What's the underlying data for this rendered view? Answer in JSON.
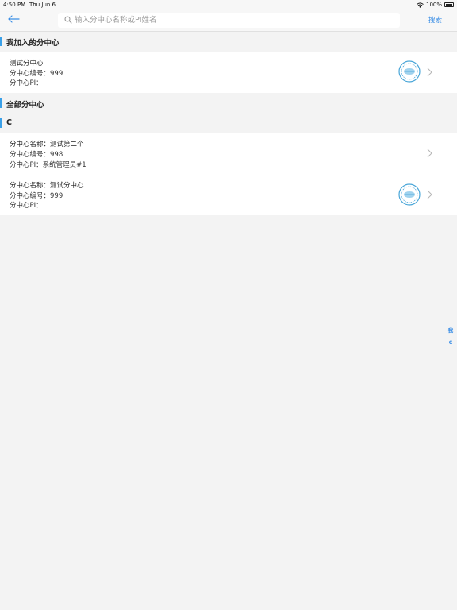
{
  "status_bar": {
    "time": "4:50 PM",
    "date": "Thu Jun 6",
    "battery": "100%"
  },
  "nav": {
    "back_icon": "arrow-left-icon",
    "search_placeholder": "输入分中心名称或PI姓名",
    "search_value": "",
    "search_button": "搜索"
  },
  "sections": {
    "joined_title": "我加入的分中心",
    "all_title": "全部分中心",
    "letter_c": "C"
  },
  "joined_centers": [
    {
      "name": "测试分中心",
      "number_label": "分中心编号：",
      "number": "999",
      "pi_label": "分中心PI：",
      "pi": "",
      "has_stamp": true
    }
  ],
  "all_centers": [
    {
      "name_label": "分中心名称：",
      "name": "测试第二个",
      "number_label": "分中心编号：",
      "number": "998",
      "pi_label": "分中心PI：",
      "pi": "系统管理员#1",
      "has_stamp": false
    },
    {
      "name_label": "分中心名称：",
      "name": "测试分中心",
      "number_label": "分中心编号：",
      "number": "999",
      "pi_label": "分中心PI：",
      "pi": "",
      "has_stamp": true
    }
  ],
  "index_bar": [
    "我",
    "C"
  ],
  "colors": {
    "accent": "#3a8ee6",
    "section_bar": "#3aa0e8",
    "background": "#f3f3f3"
  }
}
